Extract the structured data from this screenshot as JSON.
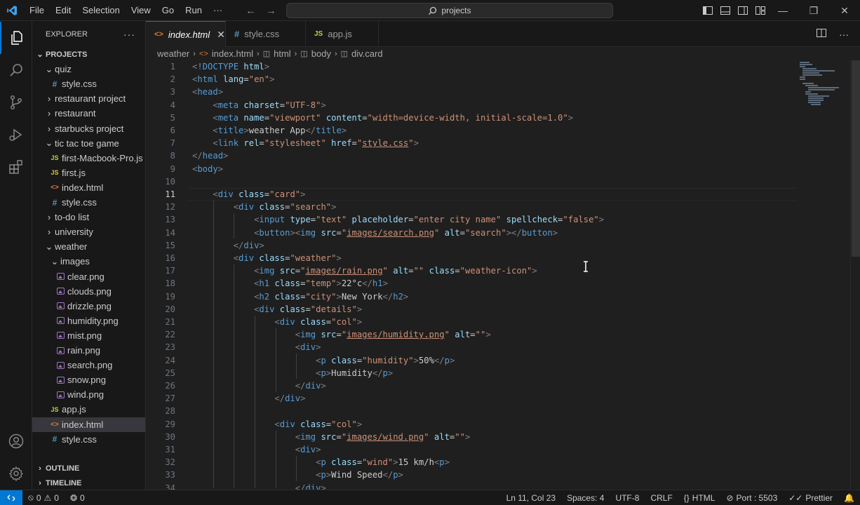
{
  "titlebar": {
    "menu": [
      "File",
      "Edit",
      "Selection",
      "View",
      "Go",
      "Run",
      "···"
    ],
    "search": "projects"
  },
  "colors": {
    "accent": "#0078d4",
    "background": "#1f1f1f"
  },
  "explorer": {
    "header": "EXPLORER",
    "root": "PROJECTS",
    "items": [
      {
        "label": "quiz",
        "kind": "folder-open"
      },
      {
        "label": "style.css",
        "kind": "css"
      },
      {
        "label": "restaurant project",
        "kind": "folder"
      },
      {
        "label": "restaurant",
        "kind": "folder"
      },
      {
        "label": "starbucks project",
        "kind": "folder"
      },
      {
        "label": "tic tac toe game",
        "kind": "folder-open"
      },
      {
        "label": "first-Macbook-Pro.js",
        "kind": "js"
      },
      {
        "label": "first.js",
        "kind": "js"
      },
      {
        "label": "index.html",
        "kind": "html"
      },
      {
        "label": "style.css",
        "kind": "css"
      },
      {
        "label": "to-do list",
        "kind": "folder"
      },
      {
        "label": "university",
        "kind": "folder"
      },
      {
        "label": "weather",
        "kind": "folder-open"
      },
      {
        "label": "images",
        "kind": "folder-open"
      },
      {
        "label": "clear.png",
        "kind": "image"
      },
      {
        "label": "clouds.png",
        "kind": "image"
      },
      {
        "label": "drizzle.png",
        "kind": "image"
      },
      {
        "label": "humidity.png",
        "kind": "image"
      },
      {
        "label": "mist.png",
        "kind": "image"
      },
      {
        "label": "rain.png",
        "kind": "image"
      },
      {
        "label": "search.png",
        "kind": "image"
      },
      {
        "label": "snow.png",
        "kind": "image"
      },
      {
        "label": "wind.png",
        "kind": "image"
      },
      {
        "label": "app.js",
        "kind": "js"
      },
      {
        "label": "index.html",
        "kind": "html"
      },
      {
        "label": "style.css",
        "kind": "css"
      }
    ],
    "outline": "OUTLINE",
    "timeline": "TIMELINE"
  },
  "tabs": [
    {
      "label": "index.html",
      "icon": "<>",
      "active": true
    },
    {
      "label": "style.css",
      "icon": "#",
      "active": false
    },
    {
      "label": "app.js",
      "icon": "JS",
      "active": false
    }
  ],
  "breadcrumbs": [
    "weather",
    "index.html",
    "html",
    "body",
    "div.card"
  ],
  "editor": {
    "current_line": 11,
    "line_numbers": [
      "1",
      "2",
      "3",
      "4",
      "5",
      "6",
      "7",
      "8",
      "9",
      "10",
      "11",
      "12",
      "13",
      "14",
      "15",
      "16",
      "17",
      "18",
      "19",
      "20",
      "21",
      "22",
      "23",
      "24",
      "25",
      "26",
      "27",
      "28",
      "29",
      "30",
      "31",
      "32",
      "33",
      "34"
    ]
  },
  "statusbar": {
    "errors": "0",
    "warnings": "0",
    "ports": "0",
    "position": "Ln 11, Col 23",
    "spaces": "Spaces: 4",
    "encoding": "UTF-8",
    "eol": "CRLF",
    "language": "HTML",
    "port": "Port : 5503",
    "prettier": "Prettier"
  }
}
